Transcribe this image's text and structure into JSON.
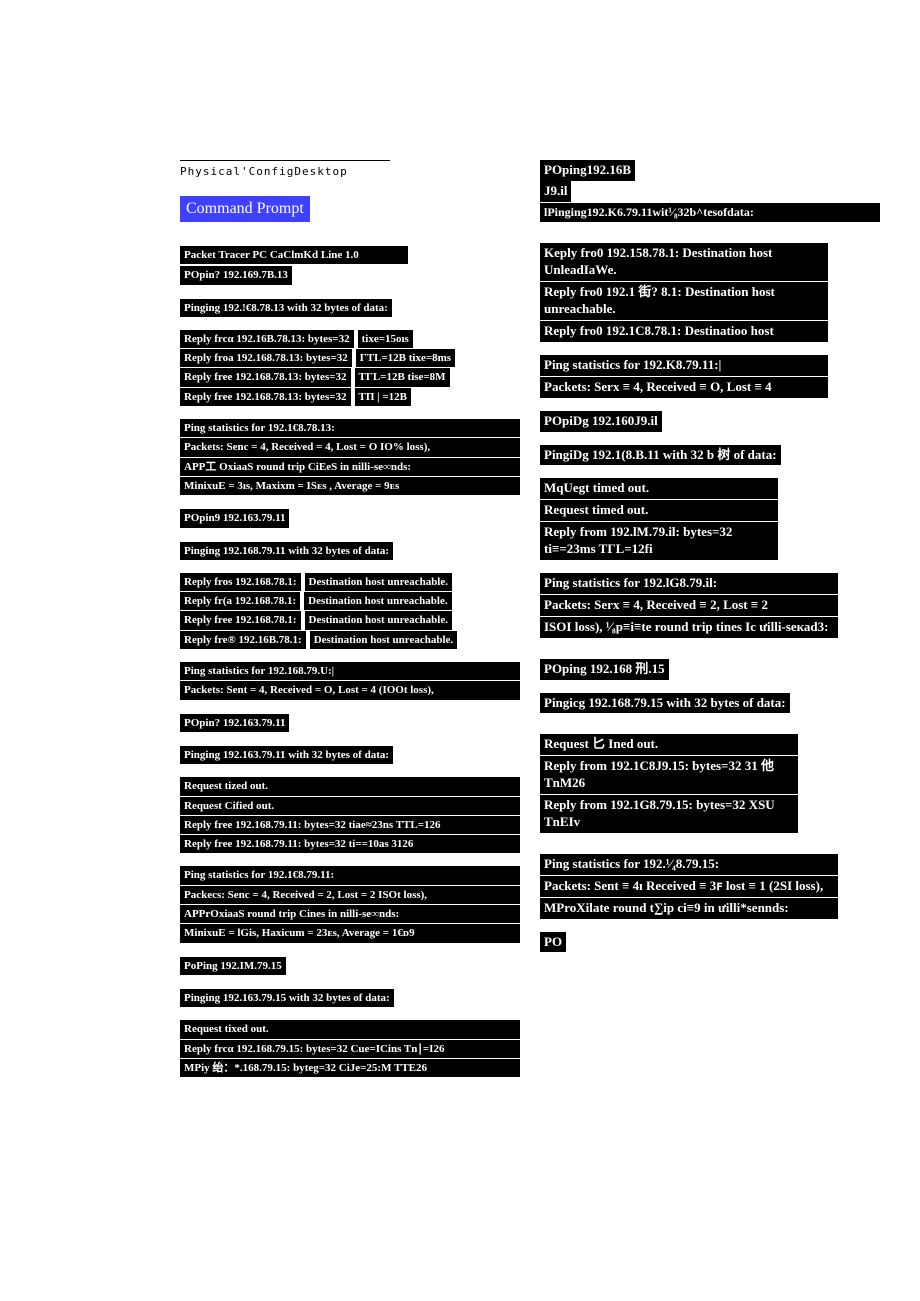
{
  "header": {
    "config": "Physical'ConfigDesktop",
    "prompt": "Command Prompt"
  },
  "left": {
    "intro1": "Packet Tracer PC CaClmKd Line 1.0",
    "intro2": "POpin? 192.169.7B.13",
    "ping1_header": "Pinging 192.!€8.78.13 with 32 bytes of data:",
    "r1a": "Reply frcα 192.16B.78.13: bytes=32",
    "r1at": "tixe=15oıs",
    "r1b": "Reply froa 192.168.78.13: bytes=32",
    "r1bt": "ΓTL=12B tixe=8ms",
    "r1c": "Reply free 192.168.78.13: bytes=32",
    "r1ct": "TΓL=12B tise=8M",
    "r1d": "Reply free 192.168.78.13: bytes=32",
    "r1dt": "TП | =12B",
    "stats1a": "Ping statistics for 192.1€8.78.13:",
    "stats1b": "    Packets: Senc = 4, Received = 4, Lost = O IO% loss),",
    "stats1c": "APP工 OxiaaS round trip CiEeS in nilli-se∞nds:",
    "stats1d": "    MinixuE = 3ıs, Maxixm = ISᴇs , Average = 9ᴇs",
    "ping2_cmd": "POpin9 192.163.79.11",
    "ping2_header": "Pinging 192.168.79.11 with 32 bytes of data:",
    "r2a": "Reply fros 192.168.78.1:",
    "r2at": "Destination host unreachable.",
    "r2b": "Reply fr(a 192.168.78.1:",
    "r2c": "Reply free 192.168.78.1:",
    "r2d": "Reply fre® 192.16B.78.1:",
    "stats2a": "Ping statistics for 192.168.79.U:|",
    "stats2b": "    Packets: Sent = 4, Received = O, Lost = 4 (IOOt loss),",
    "ping3_cmd": "POpin? 192.163.79.11",
    "ping3_header": "Pinging 192.163.79.11 with 32 bytes of data:",
    "r3a": "Request tized out.",
    "r3b": "Request Cified out.",
    "r3c": "Reply free 192.168.79.11: bytes=32 tiae≈23ns TTL=126",
    "r3d": "Reply free 192.168.79.11: bytes=32 ti==10as 3126",
    "stats3a": "Ping statistics for 192.1€8.79.11:",
    "stats3b": "   Packecs: Senc = 4, Received = 2, Lost = 2 ISOt loss),",
    "stats3c": "APPrOxiaaS round trip Cines in nilli-se∞nds:",
    "stats3d": "    MinixuE = lGis, Haxicum = 23ᴇs, Average = 1€ᴅ9",
    "ping4_cmd": "PoPing 192.IM.79.15",
    "ping4_header": "Pinging 192.163.79.15 with 32 bytes of data:",
    "r4a": "Request tixed out.",
    "r4b": "Reply frcα 192.168.79.15: bytes=32 Cue=ICins Tn∣=I26",
    "r4c": "MPiy 绐：*.168.79.15: byteg=32 CiJe=25:M TTE26"
  },
  "right": {
    "top1": "POping192.16B",
    "top2": "J9.il",
    "top3": "lPinging192.K6.79.11wit¹⁄₈32b^tesofdata:",
    "k1": "Keply fro0 192.158.78.1: Destination host UnleadIaWe.",
    "k2": "Reply fro0 192.1 街? 8.1: Destination host unreachable.",
    "k3": "Reply fro0 192.1C8.78.1: Destinatioo host",
    "stats_k1": "Ping statistics for 192.K8.79.11:|",
    "stats_k2": "    Packets: Serx ≡ 4, Received ≡ O, Lost ≡ 4",
    "ping5_cmd": "POpiDg 192.160J9.il",
    "ping5_header": "PingiDg 192.1(8.B.11 with 32 b 树 of data:",
    "r5a": "MqUegt timed out.",
    "r5b": "Request timed out.",
    "r5c": "Reply from 192.lM.79.il: bytes=32 ti≡=23ms TΓL=12fi",
    "stats5a": "Ping statistics for 192.lG8.79.il:",
    "stats5b": "    Packets: Serx ≡ 4, Received ≡ 2, Lost ≡ 2",
    "stats5c": "ISOI loss), ¹⁄₈p≡i≡te round trip tines Ic ưilli-sекаd3:",
    "ping6_cmd": "POping 192.168 刑.15",
    "ping6_header": "Pingicg 192.168.79.15 with 32 bytes of data:",
    "r6a": "Request 匕 Ined out.",
    "r6b": "Reply from 192.1C8J9.15: bytes=32 31 他 TnM26",
    "r6c": "Reply from 192.1G8.79.15: bytes=32 XSU TnEIv",
    "stats6a": "Ping statistics for 192.¹⁄₄8.79.15:",
    "stats6b": "    Packets: Sent ≡ 4ı Received ≡ 3ꜰ lost ≡ 1 (2SI loss),",
    "stats6c": "MProXilate round t∑ip ci≡9 in ưilli*sennds:",
    "po": "PO"
  }
}
